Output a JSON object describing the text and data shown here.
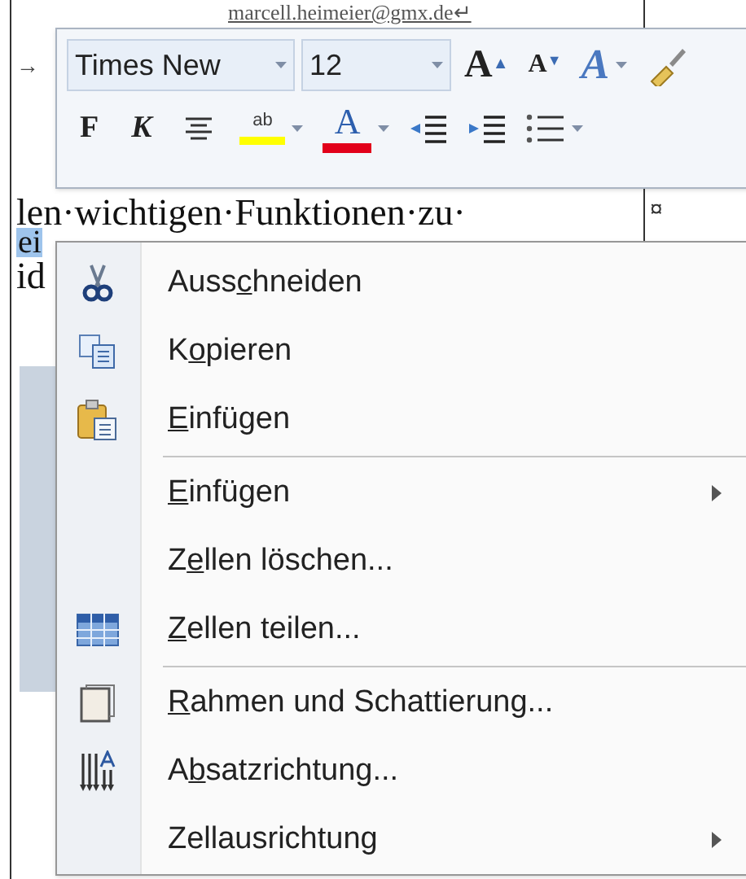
{
  "document": {
    "header_line": "marcell.heimeier@gmx.de↵",
    "tab_mark": "→",
    "body_line": "len·wichtigen·Funktionen·zu·",
    "cell_mark": "¤",
    "selected_text": "ei",
    "line_start": "id"
  },
  "mini_toolbar": {
    "font_name": {
      "value": "Times New"
    },
    "font_size": {
      "value": "12"
    },
    "row1": [
      {
        "kind": "grow",
        "label": "A",
        "mark": "▲"
      },
      {
        "kind": "shrink",
        "label": "A",
        "mark": "▼"
      },
      {
        "kind": "styles",
        "label": "A"
      },
      {
        "kind": "painter"
      }
    ],
    "row2": [
      {
        "kind": "bold",
        "label": "F"
      },
      {
        "kind": "italic",
        "label": "K"
      },
      {
        "kind": "center"
      },
      {
        "kind": "highlight",
        "label": "ab"
      },
      {
        "kind": "fontcolor",
        "label": "A"
      },
      {
        "kind": "outdent"
      },
      {
        "kind": "indent"
      },
      {
        "kind": "bullets"
      }
    ]
  },
  "context_menu": {
    "items": [
      {
        "kind": "cut",
        "pre": "Auss",
        "key": "c",
        "post": "hneiden",
        "submenu": false
      },
      {
        "kind": "copy",
        "pre": "K",
        "key": "o",
        "post": "pieren",
        "submenu": false
      },
      {
        "kind": "paste",
        "key": "E",
        "post": "infügen",
        "submenu": false
      },
      {
        "kind": "separator"
      },
      {
        "kind": "plain",
        "key": "E",
        "post": "infügen",
        "submenu": true
      },
      {
        "kind": "plain",
        "pre": "Z",
        "key": "e",
        "post": "llen löschen...",
        "submenu": false
      },
      {
        "kind": "table",
        "key": "Z",
        "post": "ellen teilen...",
        "submenu": false
      },
      {
        "kind": "separator"
      },
      {
        "kind": "border",
        "key": "R",
        "post": "ahmen und Schattierung...",
        "submenu": false
      },
      {
        "kind": "direction",
        "pre": "A",
        "key": "b",
        "post": "satzrichtung...",
        "submenu": false
      },
      {
        "kind": "plain",
        "pre": "Zellausrichtung",
        "submenu": true
      }
    ]
  }
}
